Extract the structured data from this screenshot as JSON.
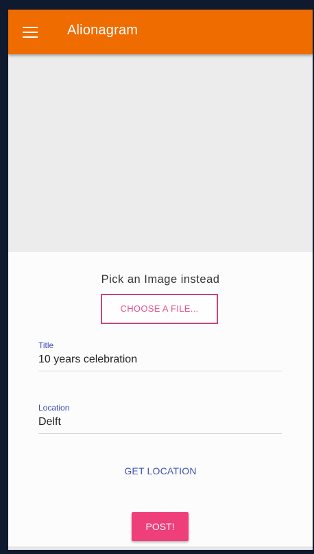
{
  "appbar": {
    "title": "Alionagram",
    "color": "#ef6c00"
  },
  "icons": {
    "menu": "menu-icon"
  },
  "image_picker": {
    "prompt": "Pick an Image instead",
    "button_label": "CHOOSE A FILE..."
  },
  "form": {
    "title": {
      "label": "Title",
      "value": "10 years celebration"
    },
    "location": {
      "label": "Location",
      "value": "Delft"
    }
  },
  "actions": {
    "get_location_label": "GET LOCATION",
    "post_label": "POST!"
  },
  "colors": {
    "accent": "#ee3f7a",
    "primary": "#3f51b5",
    "capture_background": "#ececec"
  }
}
